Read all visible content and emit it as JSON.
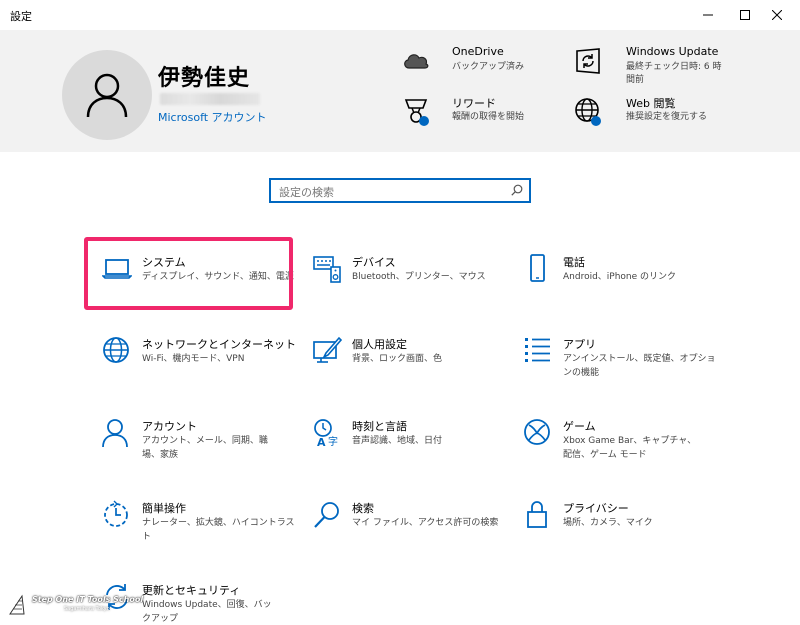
{
  "window": {
    "title": "設定"
  },
  "header": {
    "user_name": "伊勢佳史",
    "account_link": "Microsoft アカウント",
    "items": [
      {
        "title": "OneDrive",
        "sub": "バックアップ済み",
        "icon": "cloud-icon"
      },
      {
        "title": "Windows Update",
        "sub1": "最終チェック日時: 6 時",
        "sub2": "間前",
        "icon": "windows-update-icon"
      },
      {
        "title": "リワード",
        "sub": "報酬の取得を開始",
        "icon": "rewards-icon"
      },
      {
        "title": "Web 閲覧",
        "sub": "推奨設定を復元する",
        "icon": "globe-icon"
      }
    ]
  },
  "search": {
    "placeholder": "設定の検索"
  },
  "tiles": [
    {
      "title": "システム",
      "sub": "ディスプレイ、サウンド、通知、電源",
      "icon": "laptop-icon"
    },
    {
      "title": "デバイス",
      "sub": "Bluetooth、プリンター、マウス",
      "icon": "keyboard-speaker-icon"
    },
    {
      "title": "電話",
      "sub": "Android、iPhone のリンク",
      "icon": "phone-icon"
    },
    {
      "title": "ネットワークとインターネット",
      "sub": "Wi-Fi、機内モード、VPN",
      "icon": "globe-icon"
    },
    {
      "title": "個人用設定",
      "sub": "背景、ロック画面、色",
      "icon": "personalization-icon"
    },
    {
      "title": "アプリ",
      "sub": "アンインストール、既定値、オプションの機能",
      "icon": "apps-list-icon"
    },
    {
      "title": "アカウント",
      "sub": "アカウント、メール、同期、職場、家族",
      "icon": "person-icon"
    },
    {
      "title": "時刻と言語",
      "sub": "音声認識、地域、日付",
      "icon": "time-language-icon"
    },
    {
      "title": "ゲーム",
      "sub": "Xbox Game Bar、キャプチャ、配信、ゲーム モード",
      "icon": "xbox-icon"
    },
    {
      "title": "簡単操作",
      "sub": "ナレーター、拡大鏡、ハイコントラスト",
      "icon": "ease-of-access-icon"
    },
    {
      "title": "検索",
      "sub": "マイ ファイル、アクセス許可の検索",
      "icon": "search-icon"
    },
    {
      "title": "プライバシー",
      "sub": "場所、カメラ、マイク",
      "icon": "lock-icon"
    },
    {
      "title": "更新とセキュリティ",
      "sub": "Windows Update、回復、バックアップ",
      "icon": "update-sync-icon"
    }
  ],
  "watermark": {
    "text": "Step One IT Tools School",
    "sub": "Sagamihara Tokyo"
  },
  "colors": {
    "accent": "#0067c0",
    "highlight": "#f0286b",
    "header_bg": "#f2f2f2"
  }
}
